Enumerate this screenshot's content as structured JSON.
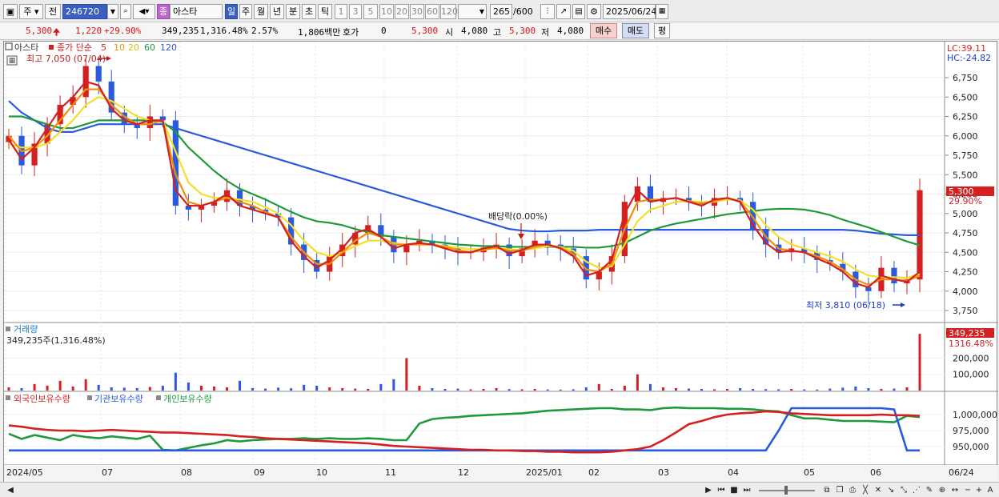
{
  "toolbar": {
    "mode": "주",
    "prev_label": "전",
    "code": "246720",
    "stock_badge": "종",
    "stock_name": "아스타",
    "periods": [
      "일",
      "주",
      "월",
      "년",
      "분",
      "초",
      "틱"
    ],
    "period_selected": "일",
    "intervals": [
      "1",
      "3",
      "5",
      "10",
      "20",
      "30",
      "60",
      "120"
    ],
    "count": "265",
    "count_total": "/600",
    "date": "2025/06/24"
  },
  "info": {
    "price": "5,300",
    "change": "1,220",
    "change_pct": "+29.90%",
    "volume": "349,235",
    "vol_ratio": "1,316.48%",
    "turnover": "2.57%",
    "amount": "1,806백만",
    "hoga_label": "호가",
    "hoga_value": "0",
    "hoga_price": "5,300",
    "open_label": "시",
    "open": "4,080",
    "high_label": "고",
    "high": "5,300",
    "low_label": "저",
    "low": "4,080",
    "buy_label": "매수",
    "sell_label": "매도",
    "avg_label": "평"
  },
  "price_panel": {
    "name": "아스타",
    "ma_title": "종가 단순",
    "ma_periods": [
      "5",
      "10",
      "20",
      "60",
      "120"
    ],
    "ma_colors": [
      "#d42020",
      "#f0900a",
      "#f2e02a",
      "#1e9a3c",
      "#2a5ae0"
    ],
    "high_note": "최고 7,050 (07/04)",
    "low_note": "최저 3,810 (06/18)",
    "dividend_note": "배당락(0.00%)",
    "lc": "LC:39.11",
    "hc": "HC:-24.82",
    "price_tag": "5,300",
    "pct_tag": "29.90%",
    "y_labels": [
      "6,750",
      "6,500",
      "6,250",
      "6,000",
      "5,750",
      "5,500",
      "5,250",
      "5,000",
      "4,750",
      "4,500",
      "4,250",
      "4,000",
      "3,750"
    ]
  },
  "volume_panel": {
    "title": "거래량",
    "value_text": "349,235주(1,316.48%)",
    "tag1": "349,235",
    "tag2": "1316.48%",
    "y_labels": [
      "200,000",
      "100,000"
    ]
  },
  "holding_panel": {
    "legend": [
      "외국인보유수량",
      "기관보유수량",
      "개인보유수량"
    ],
    "legend_colors": [
      "#d42020",
      "#2a5ae0",
      "#1e9a3c"
    ],
    "y_labels": [
      "1,000,000",
      "975,000",
      "950,000"
    ]
  },
  "x_axis": {
    "labels": [
      "2024/05",
      "07",
      "08",
      "09",
      "10",
      "11",
      "12",
      "2025/01",
      "02",
      "03",
      "04",
      "05",
      "06"
    ],
    "right_label": "06/24"
  },
  "chart_data": {
    "type": "candlestick",
    "title": "아스타",
    "y_range": [
      3700,
      7000
    ],
    "close_series": [
      6000,
      5620,
      5900,
      6150,
      6400,
      6500,
      6900,
      6700,
      6300,
      6150,
      6100,
      6250,
      6200,
      5100,
      5050,
      5100,
      5150,
      5300,
      5100,
      5050,
      5000,
      4950,
      4600,
      4400,
      4250,
      4450,
      4600,
      4750,
      4850,
      4700,
      4500,
      4600,
      4650,
      4600,
      4550,
      4500,
      4500,
      4560,
      4600,
      4450,
      4550,
      4650,
      4600,
      4550,
      4450,
      4150,
      4250,
      4450,
      5150,
      5350,
      5150,
      5200,
      5200,
      5150,
      5100,
      5200,
      5200,
      5150,
      4800,
      4600,
      4500,
      4550,
      4500,
      4400,
      4350,
      4250,
      4050,
      4000,
      4300,
      4100,
      4150,
      5300
    ],
    "ma": [
      {
        "name": "5",
        "values": [
          5950,
          5700,
          5850,
          6100,
          6350,
          6500,
          6700,
          6650,
          6350,
          6200,
          6150,
          6200,
          6200,
          5300,
          5100,
          5100,
          5150,
          5250,
          5100,
          5050,
          5000,
          4950,
          4650,
          4450,
          4300,
          4400,
          4550,
          4750,
          4800,
          4700,
          4550,
          4600,
          4620,
          4600,
          4550,
          4500,
          4500,
          4550,
          4580,
          4480,
          4530,
          4600,
          4600,
          4550,
          4450,
          4200,
          4250,
          4400,
          5000,
          5300,
          5150,
          5180,
          5200,
          5150,
          5100,
          5180,
          5200,
          5150,
          4850,
          4620,
          4500,
          4520,
          4500,
          4420,
          4350,
          4250,
          4100,
          4050,
          4200,
          4150,
          4120,
          4250
        ]
      },
      {
        "name": "10",
        "values": [
          6000,
          5800,
          5850,
          6000,
          6200,
          6400,
          6600,
          6600,
          6400,
          6250,
          6150,
          6150,
          6200,
          5500,
          5150,
          5100,
          5150,
          5200,
          5150,
          5100,
          5020,
          4950,
          4700,
          4500,
          4350,
          4350,
          4500,
          4650,
          4750,
          4700,
          4600,
          4600,
          4600,
          4600,
          4570,
          4530,
          4500,
          4530,
          4560,
          4520,
          4520,
          4570,
          4600,
          4560,
          4480,
          4280,
          4250,
          4350,
          4800,
          5150,
          5180,
          5180,
          5200,
          5160,
          5120,
          5160,
          5200,
          5160,
          4950,
          4700,
          4550,
          4520,
          4500,
          4450,
          4380,
          4280,
          4150,
          4080,
          4150,
          4150,
          4130,
          4200
        ]
      },
      {
        "name": "20",
        "values": [
          5900,
          5850,
          5850,
          5900,
          6050,
          6200,
          6400,
          6500,
          6450,
          6350,
          6250,
          6200,
          6200,
          5800,
          5400,
          5250,
          5200,
          5200,
          5180,
          5150,
          5080,
          5000,
          4850,
          4650,
          4500,
          4450,
          4500,
          4580,
          4650,
          4650,
          4620,
          4600,
          4600,
          4600,
          4580,
          4560,
          4540,
          4540,
          4550,
          4540,
          4530,
          4550,
          4580,
          4570,
          4520,
          4380,
          4300,
          4320,
          4600,
          4900,
          5050,
          5100,
          5150,
          5160,
          5150,
          5150,
          5180,
          5170,
          5050,
          4850,
          4700,
          4600,
          4550,
          4500,
          4450,
          4380,
          4280,
          4200,
          4180,
          4180,
          4170,
          4220
        ]
      },
      {
        "name": "60",
        "values": [
          6250,
          6250,
          6200,
          6150,
          6100,
          6100,
          6150,
          6200,
          6200,
          6200,
          6200,
          6200,
          6180,
          6050,
          5850,
          5700,
          5550,
          5420,
          5320,
          5250,
          5180,
          5100,
          5020,
          4950,
          4900,
          4880,
          4850,
          4800,
          4760,
          4720,
          4700,
          4680,
          4660,
          4640,
          4620,
          4600,
          4590,
          4580,
          4580,
          4570,
          4570,
          4570,
          4570,
          4570,
          4570,
          4560,
          4560,
          4580,
          4620,
          4700,
          4780,
          4830,
          4870,
          4900,
          4930,
          4960,
          4990,
          5010,
          5030,
          5050,
          5060,
          5060,
          5050,
          5020,
          4980,
          4920,
          4870,
          4820,
          4760,
          4700,
          4640,
          4590
        ]
      },
      {
        "name": "120",
        "values": [
          6450,
          6300,
          6200,
          6100,
          6050,
          6050,
          6100,
          6150,
          6150,
          6150,
          6150,
          6150,
          6150,
          6100,
          6050,
          6000,
          5950,
          5900,
          5850,
          5800,
          5750,
          5700,
          5650,
          5600,
          5550,
          5500,
          5450,
          5400,
          5350,
          5300,
          5250,
          5200,
          5150,
          5100,
          5050,
          5000,
          4950,
          4900,
          4850,
          4800,
          4780,
          4770,
          4770,
          4780,
          4780,
          4780,
          4790,
          4790,
          4790,
          4790,
          4790,
          4790,
          4790,
          4790,
          4790,
          4790,
          4790,
          4790,
          4790,
          4790,
          4790,
          4790,
          4790,
          4790,
          4790,
          4790,
          4780,
          4760,
          4740,
          4730,
          4720,
          4720
        ]
      }
    ],
    "volume_series": [
      20000,
      15000,
      40000,
      30000,
      60000,
      25000,
      70000,
      35000,
      20000,
      18000,
      15000,
      22000,
      30000,
      110000,
      50000,
      30000,
      25000,
      20000,
      60000,
      15000,
      12000,
      18000,
      14000,
      35000,
      30000,
      20000,
      15000,
      12000,
      10000,
      40000,
      70000,
      200000,
      30000,
      15000,
      10000,
      12000,
      8000,
      10000,
      15000,
      9000,
      8000,
      10000,
      7000,
      6000,
      8000,
      20000,
      40000,
      10000,
      30000,
      100000,
      40000,
      20000,
      15000,
      12000,
      10000,
      8000,
      10000,
      15000,
      10000,
      9000,
      8000,
      10000,
      7000,
      6000,
      12000,
      18000,
      25000,
      15000,
      10000,
      12000,
      20000,
      349235
    ],
    "foreign_holding": [
      983000,
      981000,
      978000,
      976000,
      975000,
      975000,
      974000,
      975000,
      976000,
      975000,
      974000,
      973000,
      972000,
      972000,
      971000,
      970000,
      969000,
      968000,
      966000,
      965000,
      963000,
      962000,
      961000,
      960000,
      959000,
      958000,
      957000,
      956000,
      955000,
      953000,
      951000,
      950000,
      949000,
      948000,
      947000,
      946000,
      945000,
      945000,
      944000,
      944000,
      943000,
      943000,
      942000,
      942000,
      941000,
      941000,
      941000,
      942000,
      944000,
      946000,
      950000,
      960000,
      972000,
      985000,
      990000,
      996000,
      1000000,
      1002000,
      1003000,
      1005000,
      1004000,
      1002000,
      1001000,
      1000000,
      999000,
      999000,
      999000,
      999000,
      1000000,
      999000,
      999000,
      998000
    ],
    "institution_holding": [
      944000,
      944000,
      944000,
      944000,
      944000,
      944000,
      944000,
      944000,
      944000,
      944000,
      944000,
      944000,
      944000,
      944000,
      944000,
      944000,
      944000,
      944000,
      944000,
      944000,
      944000,
      944000,
      944000,
      944000,
      944000,
      944000,
      944000,
      944000,
      944000,
      944000,
      944000,
      944000,
      944000,
      944000,
      944000,
      944000,
      944000,
      944000,
      944000,
      944000,
      944000,
      944000,
      944000,
      944000,
      944000,
      944000,
      944000,
      944000,
      944000,
      944000,
      944000,
      944000,
      944000,
      944000,
      944000,
      944000,
      944000,
      944000,
      944000,
      944000,
      975000,
      1010000,
      1010000,
      1010000,
      1010000,
      1010000,
      1010000,
      1010000,
      1010000,
      1008000,
      944000,
      944000
    ],
    "individual_holding": [
      970000,
      962000,
      968000,
      964000,
      960000,
      968000,
      965000,
      963000,
      966000,
      964000,
      962000,
      967000,
      945000,
      944000,
      948000,
      952000,
      955000,
      960000,
      958000,
      960000,
      961000,
      962000,
      962000,
      963000,
      962000,
      963000,
      962000,
      962000,
      963000,
      962000,
      960000,
      960000,
      986000,
      993000,
      995000,
      996000,
      998000,
      999000,
      1000000,
      1001000,
      1002000,
      1004000,
      1006000,
      1007000,
      1008000,
      1009000,
      1010000,
      1010000,
      1008000,
      1008000,
      1007000,
      1010000,
      1011000,
      1010000,
      1010000,
      1010000,
      1009000,
      1009000,
      1008000,
      1006000,
      1005000,
      999000,
      994000,
      994000,
      992000,
      990000,
      990000,
      990000,
      989000,
      988000,
      998000,
      996000
    ]
  }
}
